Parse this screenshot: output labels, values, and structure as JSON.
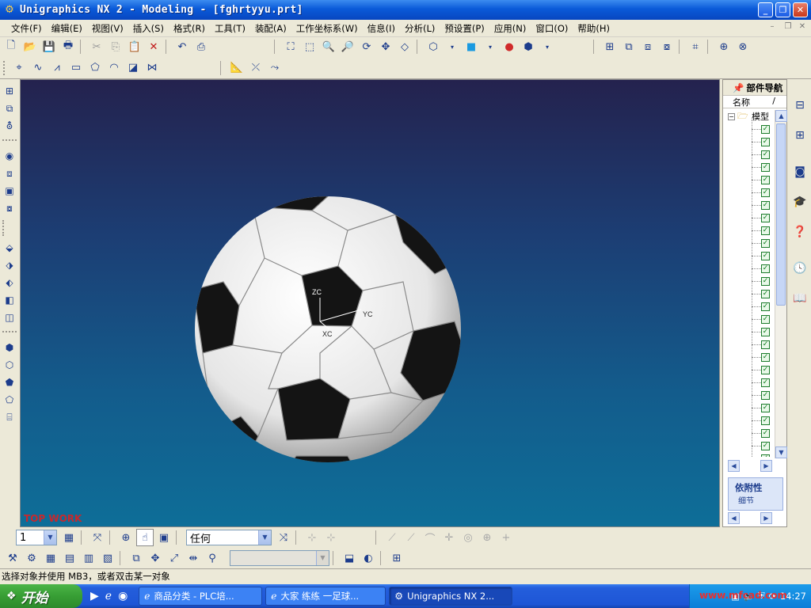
{
  "window": {
    "title": "Unigraphics NX 2 - Modeling - [fghrtyyu.prt]",
    "min": "_",
    "max": "❐",
    "close": "✕"
  },
  "menu": [
    "文件(F)",
    "编辑(E)",
    "视图(V)",
    "插入(S)",
    "格式(R)",
    "工具(T)",
    "装配(A)",
    "工作坐标系(W)",
    "信息(I)",
    "分析(L)",
    "预设置(P)",
    "应用(N)",
    "窗口(O)",
    "帮助(H)"
  ],
  "mdi": {
    "min": "–",
    "restore": "❐",
    "close": "✕"
  },
  "viewport": {
    "watermark": "TOP WORK",
    "axis": {
      "z": "ZC",
      "y": "YC",
      "x": "XC"
    }
  },
  "navigator": {
    "title": "部件导航",
    "column_name": "名称",
    "column_sort": "/",
    "root_label": "模型",
    "row_check": "✓",
    "rows": 27,
    "dependencies_label": "依附性",
    "details_label": "细节"
  },
  "bottom": {
    "layer_value": "1",
    "filter_value": "任何"
  },
  "status": "选择对象并使用 MB3，或者双击某一对象",
  "taskbar": {
    "start": "开始",
    "tasks": [
      "商品分类 - PLC培...",
      "大家 练练 一足球...",
      "Unigraphics NX 2..."
    ],
    "clock": "14:27",
    "watermark": "www.mfcad.com"
  }
}
